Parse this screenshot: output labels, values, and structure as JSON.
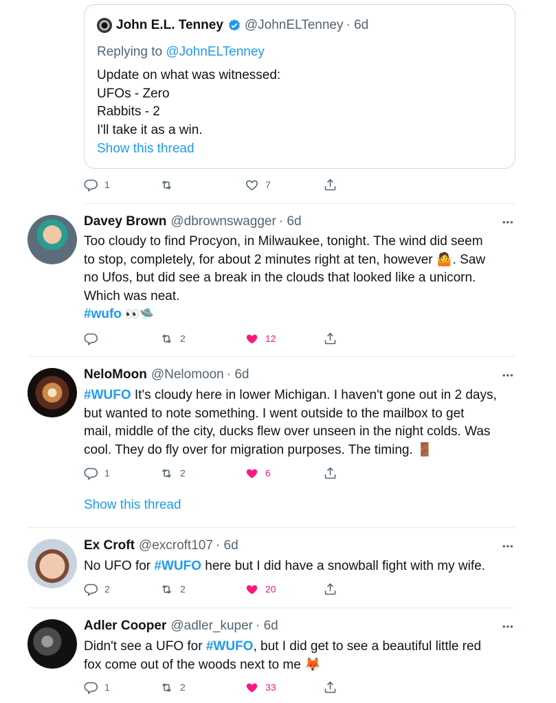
{
  "quoted": {
    "name": "John E.L. Tenney",
    "handle": "@JohnELTenney",
    "time": "· 6d",
    "replying_prefix": "Replying to",
    "replying_handle": "@JohnELTenney",
    "lines": [
      "Update on what was witnessed:",
      "UFOs - Zero",
      "Rabbits - 2",
      "I'll take it as a win."
    ],
    "show_thread": "Show this thread",
    "replies": "1",
    "retweets": "",
    "likes": "7"
  },
  "tweets": [
    {
      "name": "Davey Brown",
      "handle": "@dbrownswagger",
      "time": "· 6d",
      "lines": [
        "Too cloudy to find Procyon, in Milwaukee, tonight. The wind did seem",
        "to stop, completely, for about 2 minutes right at ten, however",
        "no Ufos, but did see a break in the clouds that looked like a unicorn.",
        "Which was neat."
      ],
      "line2_tail": "🤷. Saw",
      "hashtag": "#wufo",
      "hashtag_emoji": "👀🛸",
      "replies": "",
      "retweets": "2",
      "likes": "12"
    },
    {
      "name": "NeloMoon",
      "handle": "@Nelomoon",
      "time": "· 6d",
      "hashtag": "#WUFO",
      "line1_rest": " It's cloudy here in lower Michigan. I haven't gone out in 2 days,",
      "lines": [
        "but wanted to note something. I went outside to the mailbox to get",
        "mail, middle of the city, ducks flew over unseen in the night colds. Was",
        "cool. They do fly over for migration purposes. The timing. 🚪"
      ],
      "replies": "1",
      "retweets": "2",
      "likes": "6",
      "show_thread": "Show this thread"
    },
    {
      "name": "Ex Croft",
      "handle": "@excroft107",
      "time": "· 6d",
      "pre": "No UFO for ",
      "hashtag": "#WUFO",
      "post": " here but I did have a snowball fight with my wife.",
      "replies": "2",
      "retweets": "2",
      "likes": "20"
    },
    {
      "name": "Adler Cooper",
      "handle": "@adler_kuper",
      "time": "· 6d",
      "pre": "Didn't see a UFO for ",
      "hashtag": "#WUFO",
      "post": ", but I did get to see a beautiful little red",
      "line2": "fox come out of the woods next to me 🦊",
      "replies": "1",
      "retweets": "2",
      "likes": "33"
    }
  ],
  "more_label": "•••",
  "colors": {
    "link": "#1d9bf0",
    "like": "#f91880",
    "muted": "#536471",
    "text": "#0f1419"
  }
}
